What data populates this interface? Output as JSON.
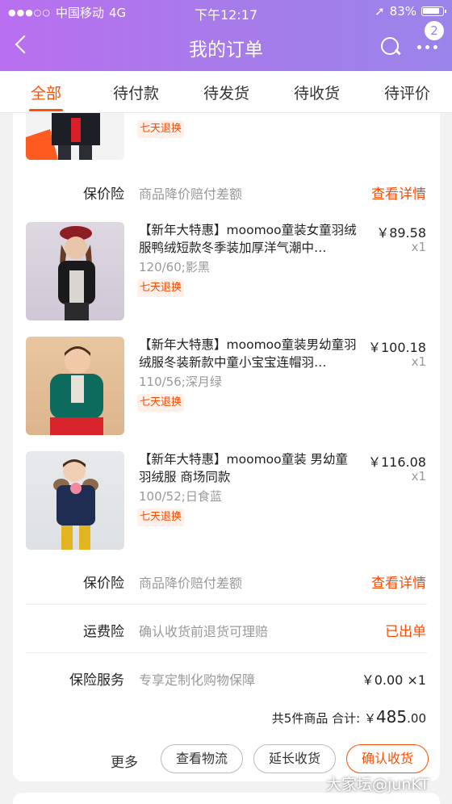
{
  "status_bar": {
    "carrier": "中国移动",
    "network": "4G",
    "time": "下午12:17",
    "battery": "83%"
  },
  "header": {
    "title": "我的订单",
    "badge_count": "2"
  },
  "tabs": [
    {
      "label": "全部",
      "active": true
    },
    {
      "label": "待付款",
      "active": false
    },
    {
      "label": "待发货",
      "active": false
    },
    {
      "label": "待收货",
      "active": false
    },
    {
      "label": "待评价",
      "active": false
    }
  ],
  "top_item": {
    "tag": "七天退换"
  },
  "price_protect_1": {
    "label": "保价险",
    "desc": "商品降价赔付差额",
    "action": "查看详情"
  },
  "products": [
    {
      "name": "【新年大特惠】moomoo童装女童羽绒服鸭绒短款冬季装加厚洋气潮中…",
      "sku": "120/60;影黑",
      "tag": "七天退换",
      "price": "￥89.58",
      "qty": "x1"
    },
    {
      "name": "【新年大特惠】moomoo童装男幼童羽绒服冬装新款中童小宝宝连帽羽…",
      "sku": "110/56;深月绿",
      "tag": "七天退换",
      "price": "￥100.18",
      "qty": "x1"
    },
    {
      "name": "【新年大特惠】moomoo童装 男幼童羽绒服 商场同款",
      "sku": "100/52;日食蓝",
      "tag": "七天退换",
      "price": "￥116.08",
      "qty": "x1"
    }
  ],
  "price_protect_2": {
    "label": "保价险",
    "desc": "商品降价赔付差额",
    "action": "查看详情"
  },
  "shipping_insurance": {
    "label": "运费险",
    "desc": "确认收货前退货可理赔",
    "action": "已出单"
  },
  "insurance_service": {
    "label": "保险服务",
    "desc": "专享定制化购物保障",
    "value": "￥0.00 ×1"
  },
  "summary": {
    "count_text": "共5件商品 合计:",
    "currency": "￥",
    "total_int": "485",
    "total_dec": ".00"
  },
  "actions": {
    "more": "更多",
    "view_logistics": "查看物流",
    "extend_receipt": "延长收货",
    "confirm_receipt": "确认收货"
  },
  "watermark": "大家坛@junKT",
  "colors": {
    "accent": "#ff5000",
    "header_start": "#ba6ff0",
    "header_end": "#9a84ea"
  }
}
